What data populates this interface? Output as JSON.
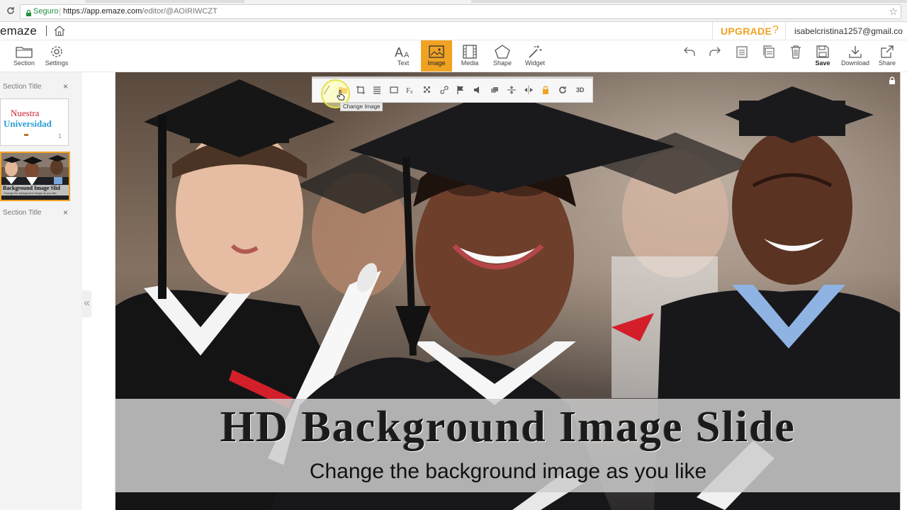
{
  "browser": {
    "secure_label": "Seguro",
    "url_host": "https://app.emaze.com",
    "url_path": "/editor/@AOIRIWCZT"
  },
  "app": {
    "logo": "emaze",
    "upgrade": "UPGRADE",
    "help": "?",
    "user_email": "isabelcristina1257@gmail.co"
  },
  "toolbar": {
    "section": "Section",
    "settings": "Settings",
    "text": "Text",
    "image": "Image",
    "media": "Media",
    "shape": "Shape",
    "widget": "Widget",
    "save": "Save",
    "download": "Download",
    "share": "Share"
  },
  "sidebar": {
    "section1_title": "Section Title",
    "section2_title": "Section Title",
    "close_glyph": "×",
    "slide1": {
      "line1": "Nuestra",
      "line2": "Universidad",
      "number": "1"
    },
    "slide2": {
      "title": "Background Image Slid",
      "subtitle": "Change the background image as you like"
    },
    "collapse_glyph": "«"
  },
  "image_toolbar": {
    "tooltip": "Change Image",
    "three_d": "3D"
  },
  "slide": {
    "title": "HD Background Image Slide",
    "subtitle": "Change the background image as you like"
  },
  "colors": {
    "accent": "#f0a323",
    "secure_green": "#1e8e3e",
    "slide1_red": "#c8202c",
    "slide1_blue": "#2a9bd6"
  }
}
